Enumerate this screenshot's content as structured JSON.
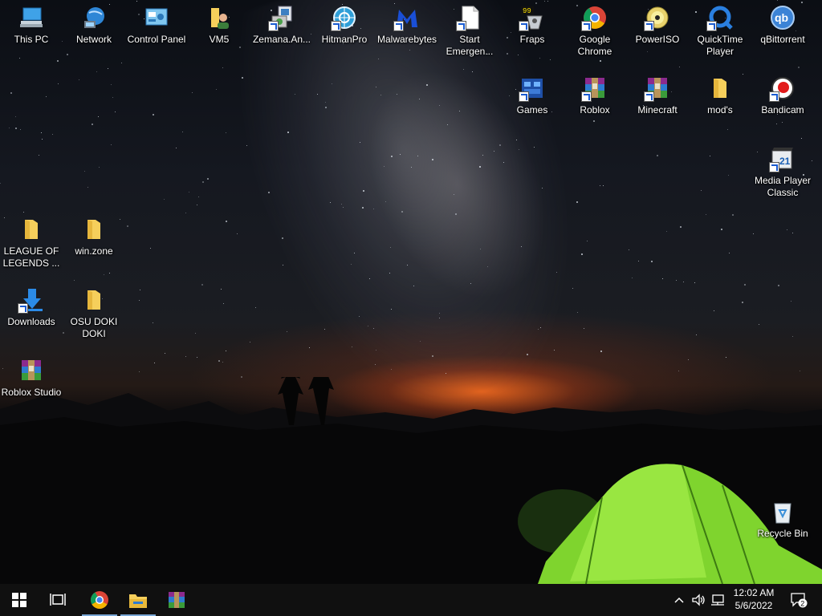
{
  "desktop": {
    "icons": {
      "this_pc": "This PC",
      "network": "Network",
      "control_panel": "Control Panel",
      "vm5": "VM5",
      "zemana": "Zemana.An...",
      "hitmanpro": "HitmanPro",
      "malwarebytes": "Malwarebytes",
      "start_emergency": "Start Emergen...",
      "fraps": "Fraps",
      "google_chrome": "Google Chrome",
      "poweriso": "PowerISO",
      "quicktime": "QuickTime Player",
      "qbittorrent": "qBittorrent",
      "games": "Games",
      "roblox": "Roblox",
      "minecraft": "Minecraft",
      "mods": "mod's",
      "bandicam": "Bandicam",
      "mpc": "Media Player Classic",
      "league": "LEAGUE OF LEGENDS ...",
      "winzone": "win.zone",
      "downloads": "Downloads",
      "osu": "OSU DOKI DOKI",
      "roblox_studio": "Roblox Studio",
      "recycle_bin": "Recycle Bin"
    },
    "fraps_badge": "99",
    "mpc_badge": "21",
    "qbittorrent_badge": "qb"
  },
  "taskbar": {
    "clock_time": "12:02 AM",
    "clock_date": "5/6/2022",
    "notification_count": "2"
  },
  "colors": {
    "taskbar": "#101010",
    "folder": "#f6cf5b",
    "tent": "#8fe03a",
    "horizon_glow": "#ff6e1e"
  }
}
